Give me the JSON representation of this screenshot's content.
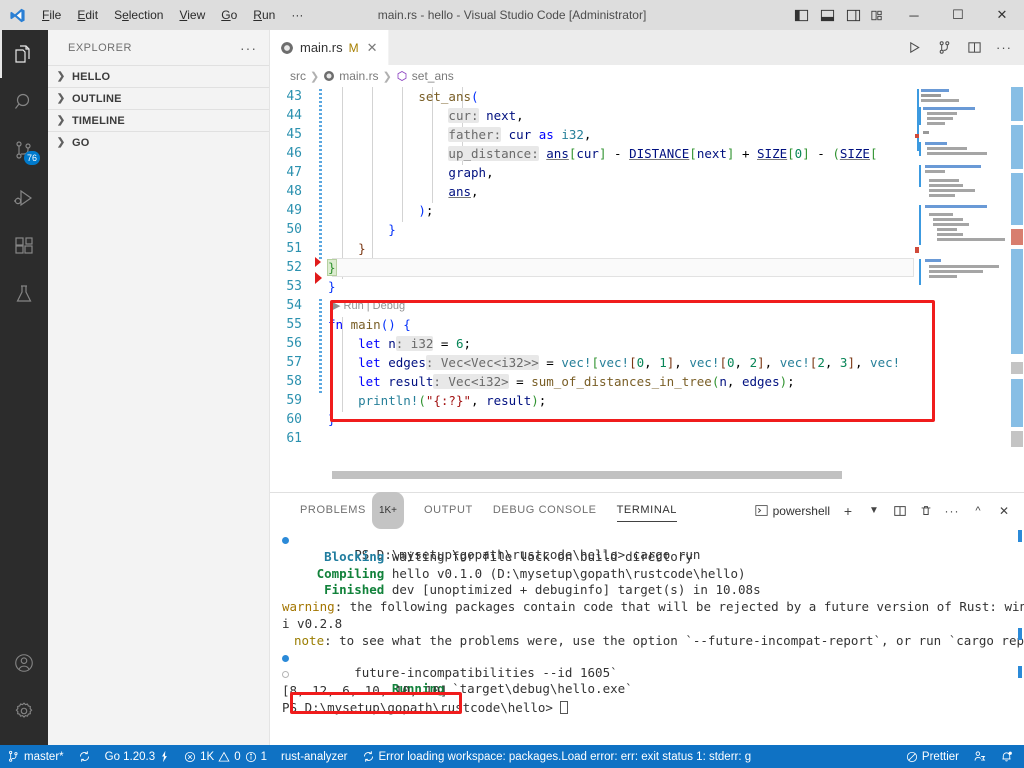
{
  "titlebar": {
    "title": "main.rs - hello - Visual Studio Code [Administrator]",
    "menus": [
      "File",
      "Edit",
      "Selection",
      "View",
      "Go",
      "Run",
      "···"
    ],
    "layout_buttons": [
      "toggle-primary-sidebar",
      "toggle-panel",
      "toggle-secondary-sidebar",
      "customize-layout"
    ],
    "window_buttons": {
      "minimize": "─",
      "maximize": "☐",
      "close": "✕"
    }
  },
  "activitybar": {
    "items": [
      {
        "name": "explorer",
        "badge": ""
      },
      {
        "name": "search",
        "badge": ""
      },
      {
        "name": "source-control",
        "badge": "76"
      },
      {
        "name": "run-and-debug",
        "badge": ""
      },
      {
        "name": "extensions",
        "badge": ""
      },
      {
        "name": "testing",
        "badge": ""
      }
    ],
    "bottom": [
      {
        "name": "accounts"
      },
      {
        "name": "manage-settings"
      }
    ]
  },
  "sidebar": {
    "title": "EXPLORER",
    "sections": [
      {
        "label": "HELLO",
        "expanded": false
      },
      {
        "label": "OUTLINE",
        "expanded": false
      },
      {
        "label": "TIMELINE",
        "expanded": false
      },
      {
        "label": "GO",
        "expanded": false
      }
    ]
  },
  "editor": {
    "tab": {
      "label": "main.rs",
      "dirty_badge": "M",
      "close": "✕"
    },
    "tab_actions": [
      "run-code",
      "run-and-debug-alt",
      "split-editor",
      "more-actions"
    ],
    "breadcrumb": [
      "src",
      "main.rs",
      "set_ans"
    ],
    "codelens": "▶ Run | Debug",
    "first_line_number": 43,
    "lines": [
      {
        "n": 43,
        "text": "            set_ans("
      },
      {
        "n": 44,
        "text": "                cur: next,"
      },
      {
        "n": 45,
        "text": "                father: cur as i32,"
      },
      {
        "n": 46,
        "text": "                up_distance: ans[cur] - DISTANCE[next] + SIZE[0] - (SIZE["
      },
      {
        "n": 47,
        "text": "                graph,"
      },
      {
        "n": 48,
        "text": "                ans,"
      },
      {
        "n": 49,
        "text": "            );"
      },
      {
        "n": 50,
        "text": "        }"
      },
      {
        "n": 51,
        "text": "    }"
      },
      {
        "n": 52,
        "text": "}"
      },
      {
        "n": 53,
        "text": "}"
      },
      {
        "n": 54,
        "text": ""
      },
      {
        "n": 55,
        "text": "fn main() {"
      },
      {
        "n": 56,
        "text": "    let n: i32 = 6;"
      },
      {
        "n": 57,
        "text": "    let edges: Vec<Vec<i32>> = vec![vec![0, 1], vec![0, 2], vec![2, 3], vec!"
      },
      {
        "n": 58,
        "text": "    let result: Vec<i32> = sum_of_distances_in_tree(n, edges);"
      },
      {
        "n": 59,
        "text": "    println!(\"{:?}\", result);"
      },
      {
        "n": 60,
        "text": "}"
      },
      {
        "n": 61,
        "text": ""
      }
    ]
  },
  "panel": {
    "tabs": [
      {
        "label": "PROBLEMS",
        "count": "1K+",
        "active": false
      },
      {
        "label": "OUTPUT",
        "count": "",
        "active": false
      },
      {
        "label": "DEBUG CONSOLE",
        "count": "",
        "active": false
      },
      {
        "label": "TERMINAL",
        "count": "",
        "active": true
      }
    ],
    "shell": "powershell",
    "actions": [
      "new-terminal",
      "terminal-dropdown",
      "split-terminal",
      "kill-terminal",
      "more-actions",
      "maximize-panel",
      "close-panel"
    ],
    "terminal_lines": [
      {
        "marker": "blue",
        "text": "PS D:\\mysetup\\gopath\\rustcode\\hello> cargo run"
      },
      {
        "marker": "none",
        "text": "    Blocking waiting for file lock on build directory",
        "tag": "Blocking",
        "tagcolor": "cyan"
      },
      {
        "marker": "none",
        "text": "   Compiling hello v0.1.0 (D:\\mysetup\\gopath\\rustcode\\hello)",
        "tag": "Compiling",
        "tagcolor": "green"
      },
      {
        "marker": "none",
        "text": "    Finished dev [unoptimized + debuginfo] target(s) in 10.08s",
        "tag": "Finished",
        "tagcolor": "green"
      },
      {
        "marker": "none",
        "text": "warning: the following packages contain code that will be rejected by a future version of Rust: winap"
      },
      {
        "marker": "none",
        "text": "i v0.2.8"
      },
      {
        "marker": "none",
        "text": " note: to see what the problems were, use the option `--future-incompat-report`, or run `cargo report"
      },
      {
        "marker": "blue",
        "text": "future-incompatibilities --id 1605`"
      },
      {
        "marker": "hollow",
        "text": "     Running `target\\debug\\hello.exe`",
        "tag": "Running",
        "tagcolor": "green"
      },
      {
        "marker": "none",
        "text": "[8, 12, 6, 10, 10, 10]"
      },
      {
        "marker": "none",
        "text": "PS D:\\mysetup\\gopath\\rustcode\\hello> "
      }
    ]
  },
  "statusbar": {
    "left": [
      {
        "name": "branch",
        "icon": "source-control-icon",
        "label": "master*"
      },
      {
        "name": "sync",
        "icon": "sync-icon",
        "label": ""
      },
      {
        "name": "go-version",
        "icon": "",
        "label": "Go 1.20.3"
      },
      {
        "name": "problems",
        "icon": "",
        "label": "1K ⚠ 0 ⓘ 1"
      },
      {
        "name": "rust-analyzer",
        "icon": "",
        "label": "rust-analyzer"
      },
      {
        "name": "workspace-error",
        "icon": "sync-icon",
        "label": "Error loading workspace: packages.Load error: err: exit status 1: stderr: g"
      }
    ],
    "right": [
      {
        "name": "prettier",
        "icon": "prohibited-icon",
        "label": "Prettier"
      },
      {
        "name": "remote-feedback",
        "icon": "feedback-icon",
        "label": ""
      },
      {
        "name": "notifications",
        "icon": "bell-icon",
        "label": ""
      }
    ]
  },
  "colors": {
    "accent": "#0f72c4",
    "titlebar_bg": "#dddddd",
    "activitybar_bg": "#2c2c2c",
    "sidebar_bg": "#f3f3f3",
    "highlight_box": "#f01c1c",
    "badge": "#007acc"
  }
}
